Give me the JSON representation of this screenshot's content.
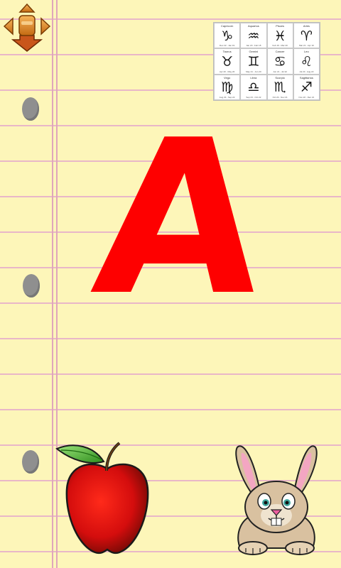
{
  "letter": "A",
  "letter_color": "#fe0000",
  "zodiac_chart": {
    "signs": [
      {
        "name": "Capricorn",
        "symbol": "♑",
        "dates": "Dec 22 - Jan 19"
      },
      {
        "name": "Aquarius",
        "symbol": "♒",
        "dates": "Jan 20 - Feb 18"
      },
      {
        "name": "Pisces",
        "symbol": "♓",
        "dates": "Feb 19 - Mar 20"
      },
      {
        "name": "Aries",
        "symbol": "♈",
        "dates": "Mar 21 - Apr 19"
      },
      {
        "name": "Taurus",
        "symbol": "♉",
        "dates": "Apr 20 - May 20"
      },
      {
        "name": "Gemini",
        "symbol": "♊",
        "dates": "May 21 - Jun 20"
      },
      {
        "name": "Cancer",
        "symbol": "♋",
        "dates": "Jun 21 - Jul 22"
      },
      {
        "name": "Leo",
        "symbol": "♌",
        "dates": "Jul 23 - Aug 22"
      },
      {
        "name": "Virgo",
        "symbol": "♍",
        "dates": "Aug 23 - Sep 22"
      },
      {
        "name": "Libra",
        "symbol": "♎",
        "dates": "Sep 23 - Oct 22"
      },
      {
        "name": "Scorpio",
        "symbol": "♏",
        "dates": "Oct 23 - Nov 21"
      },
      {
        "name": "Sagittarius",
        "symbol": "♐",
        "dates": "Nov 22 - Dec 21"
      }
    ]
  },
  "icons": {
    "nav": "directional-pad-icon",
    "left_picture": "apple-icon",
    "right_picture": "bunny-icon"
  },
  "colors": {
    "paper": "#fdf6b9",
    "rule_lines": "#e9b7c8",
    "margin_line": "#e0a6bb",
    "holes": "#8f8f8f"
  }
}
